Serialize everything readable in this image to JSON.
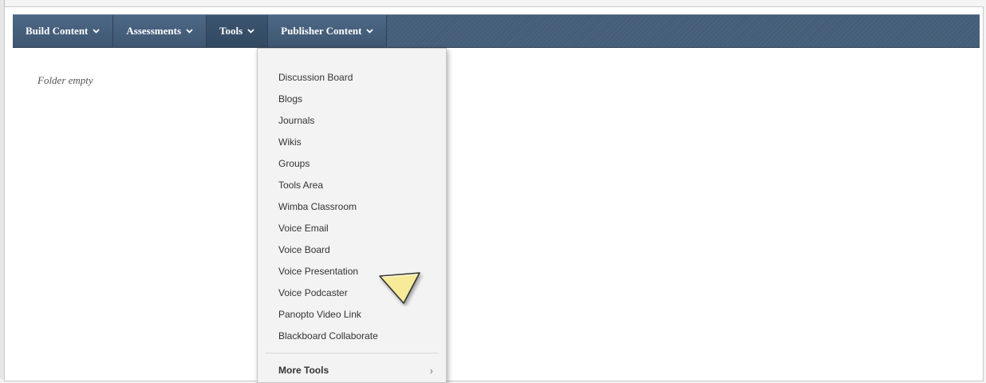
{
  "nav": {
    "tabs": [
      {
        "label": "Build Content"
      },
      {
        "label": "Assessments"
      },
      {
        "label": "Tools"
      },
      {
        "label": "Publisher Content"
      }
    ]
  },
  "content": {
    "folder_empty": "Folder empty"
  },
  "tools_menu": {
    "items": [
      "Discussion Board",
      "Blogs",
      "Journals",
      "Wikis",
      "Groups",
      "Tools Area",
      "Wimba Classroom",
      "Voice Email",
      "Voice Board",
      "Voice Presentation",
      "Voice Podcaster",
      "Panopto Video Link",
      "Blackboard Collaborate"
    ],
    "more_tools": "More Tools"
  },
  "colors": {
    "nav_background": "#445d78",
    "menu_background": "#f3f3f3",
    "pointer_fill": "#f7eb9a"
  },
  "icons": {
    "caret": "chevron-down-icon",
    "more": "chevron-right-icon",
    "pointer": "pointer-arrow-icon"
  }
}
